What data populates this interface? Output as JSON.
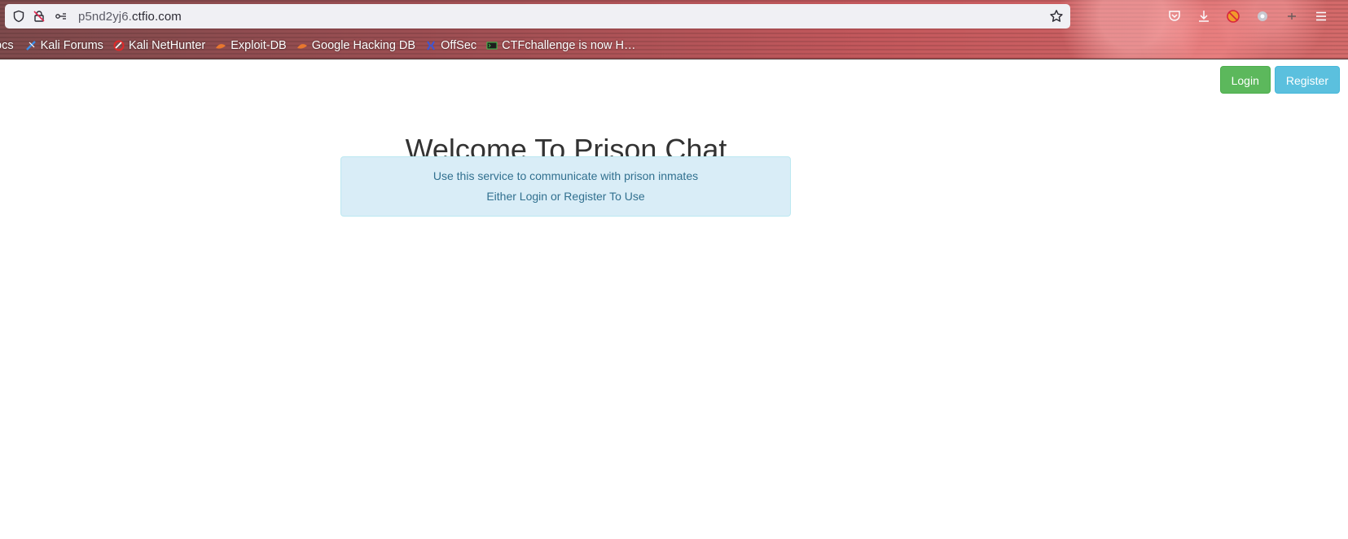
{
  "browser": {
    "url_host_prefix": "p5nd2yj6.",
    "url_host_domain": "ctfio.com",
    "bookmarks": [
      {
        "label": "ocs",
        "icon": "none"
      },
      {
        "label": "Kali Forums",
        "icon": "kali-dragon-icon"
      },
      {
        "label": "Kali NetHunter",
        "icon": "nethunter-icon"
      },
      {
        "label": "Exploit-DB",
        "icon": "exploit-db-icon"
      },
      {
        "label": "Google Hacking DB",
        "icon": "ghdb-icon"
      },
      {
        "label": "OffSec",
        "icon": "offsec-icon"
      },
      {
        "label": "CTFchallenge is now H…",
        "icon": "terminal-icon"
      }
    ]
  },
  "header": {
    "login_label": "Login",
    "register_label": "Register"
  },
  "main": {
    "title": "Welcome To Prison Chat",
    "info_line1": "Use this service to communicate with prison inmates",
    "info_line2_prefix": "Either ",
    "info_line2_login": "Login",
    "info_line2_middle": " or ",
    "info_line2_register": "Register",
    "info_line2_suffix": " To Use"
  },
  "colors": {
    "login_button": "#5cb85c",
    "register_button": "#5bc0de",
    "info_background": "#d9edf7",
    "info_text": "#31708f",
    "title_text": "#333333"
  }
}
